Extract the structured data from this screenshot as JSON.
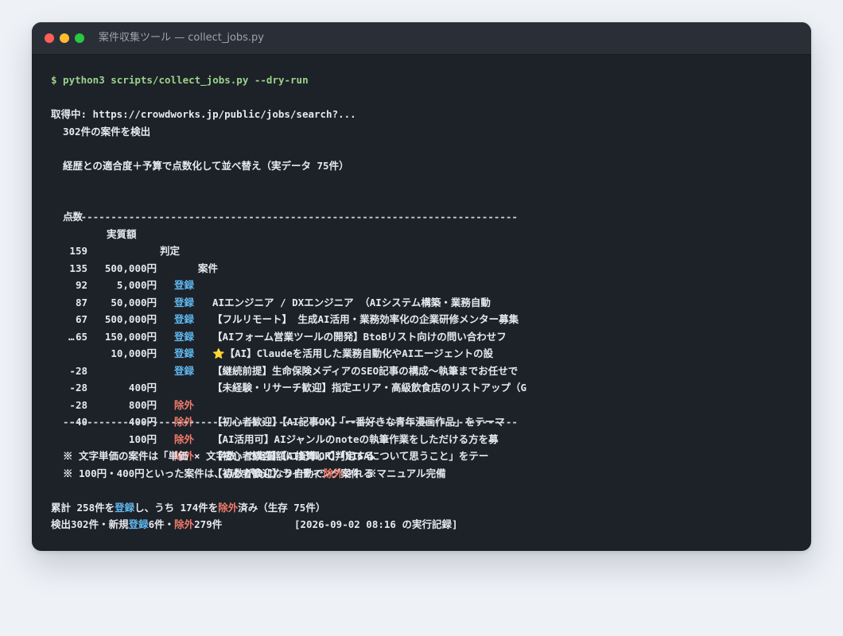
{
  "window": {
    "title": "案件収集ツール — collect_jobs.py"
  },
  "command": "$ python3 scripts/collect_jobs.py --dry-run",
  "fetch_line": "取得中: https://crowdworks.jp/public/jobs/search?...",
  "detected_line": "302件の案件を検出",
  "sort_line": "経歴との適合度＋予算で点数化して並べ替え（実データ 75件）",
  "table": {
    "headers": {
      "score": "点数",
      "amount": "実質額",
      "verdict": "判定",
      "title": "案件"
    },
    "separator": "----------------------------------------------------------------------------",
    "top_rows": [
      {
        "score": "159",
        "amount": "500,000円",
        "verdict": "登録",
        "title": "AIエンジニア / DXエンジニア （AIシステム構築・業務自動"
      },
      {
        "score": "135",
        "amount": "5,000円",
        "verdict": "登録",
        "title": "【フルリモート】 生成AI活用・業務効率化の企業研修メンター募集"
      },
      {
        "score": "92",
        "amount": "50,000円",
        "verdict": "登録",
        "title": "【AIフォーム営業ツールの開発】BtoBリスト向けの問い合わせフ"
      },
      {
        "score": "87",
        "amount": "500,000円",
        "verdict": "登録",
        "title": "⭐【AI】Claudeを活用した業務自動化やAIエージェントの設"
      },
      {
        "score": "67",
        "amount": "150,000円",
        "verdict": "登録",
        "title": "【継続前提】生命保険メディアのSEO記事の構成〜執筆までお任せで"
      },
      {
        "score": "65",
        "amount": "10,000円",
        "verdict": "登録",
        "title": "【未経験・リサーチ歓迎】指定エリア・高級飲食店のリストアップ（G"
      }
    ],
    "ellipsis": "…",
    "bottom_rows": [
      {
        "score": "-28",
        "amount": "400円",
        "verdict": "除外",
        "title": "【初心者歓迎】【AI記事OK】「一番好きな青年漫画作品」をテーマ"
      },
      {
        "score": "-28",
        "amount": "800円",
        "verdict": "除外",
        "title": "【AI活用可】AIジャンルのnoteの執筆作業をしただける方を募"
      },
      {
        "score": "-28",
        "amount": "400円",
        "verdict": "除外",
        "title": "【初心者歓迎】【AI記事OK】「NISAについて思うこと」をテー"
      },
      {
        "score": "-40",
        "amount": "100円",
        "verdict": "除外",
        "title": "【初心者歓迎】ライティング案件 ※マニュアル完備"
      }
    ]
  },
  "notes": {
    "note1": "※ 文字単価の案件は「単価 × 文字数」で実質額に換算して判定する",
    "note2_prefix": "※ 100円・400円といった案件は、点数が負になり自動で",
    "note2_highlight": "除外",
    "note2_suffix": "される"
  },
  "summary": {
    "a1": "累計 258件を",
    "a2": "登録",
    "a3": "し、うち 174件を",
    "a4": "除外",
    "a5": "済み（生存 75件）",
    "b1": "検出302件・新規",
    "b2": "登録",
    "b3": "6件・",
    "b4": "除外",
    "b5": "279件",
    "timestamp": "[2026-09-02 08:16 の実行記録]"
  },
  "colors": {
    "register": "#5fb7ee",
    "exclude": "#ef7b6a",
    "command": "#9ad38b"
  }
}
